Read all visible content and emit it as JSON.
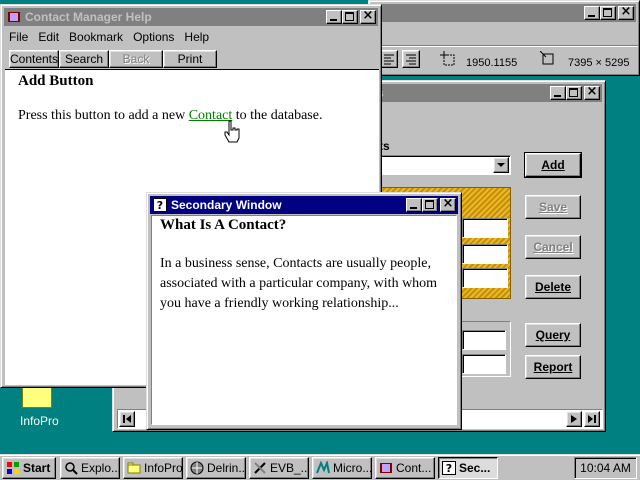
{
  "desktop": {
    "icon_label": "InfoPro"
  },
  "background_window": {
    "coord_readout": "1950.1155",
    "size_readout": "7395 × 5295"
  },
  "dialog": {
    "partial_title": "s",
    "partial_label": "ts",
    "buttons": {
      "add": "Add",
      "save": "Save",
      "cancel": "Cancel",
      "delete": "Delete",
      "query": "Query",
      "report": "Report"
    }
  },
  "help_window": {
    "title": "Contact Manager Help",
    "menu": [
      "File",
      "Edit",
      "Bookmark",
      "Options",
      "Help"
    ],
    "toolbar": [
      "Contents",
      "Search",
      "Back",
      "Print"
    ],
    "heading": "Add Button",
    "body_before": "Press this button to add a new ",
    "link": "Contact",
    "body_after": " to the database."
  },
  "secondary_window": {
    "title": "Secondary Window",
    "heading": "What Is A Contact?",
    "body": "In a business sense, Contacts are usually people, associated with a particular company, with whom you have a friendly working relationship..."
  },
  "taskbar": {
    "start": "Start",
    "tasks": [
      "Explo...",
      "InfoPro",
      "Delrin...",
      "EVB_...",
      "Micro...",
      "Cont...",
      "Sec..."
    ],
    "clock": "10:04 AM"
  },
  "colors": {
    "desktop": "#008080",
    "active_title": "#000080",
    "inactive_title": "#808080",
    "link": "#008000",
    "hatch": "#c89000"
  }
}
